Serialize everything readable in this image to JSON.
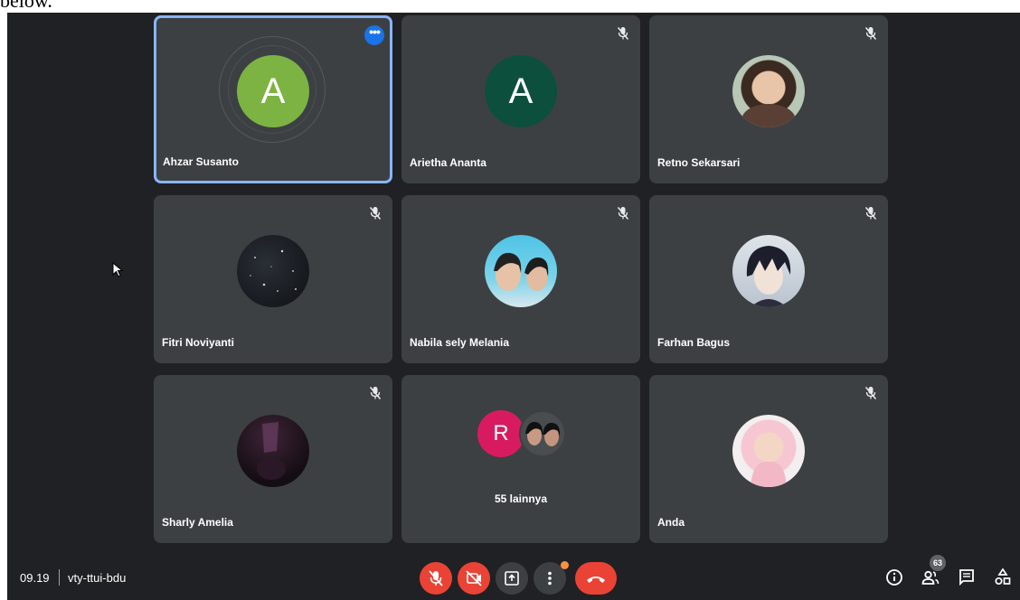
{
  "caption_fragment": "below.",
  "meeting": {
    "time": "09.19",
    "code": "vty-ttui-bdu"
  },
  "participants": [
    {
      "name": "Ahzar Susanto",
      "avatar": "letter",
      "initial": "A",
      "color": "#7cb342",
      "active": true
    },
    {
      "name": "Arietha Ananta",
      "avatar": "letter",
      "initial": "A",
      "color": "#0d4f3d",
      "muted": true
    },
    {
      "name": "Retno Sekarsari",
      "avatar": "photo",
      "muted": true
    },
    {
      "name": "Fitri Noviyanti",
      "avatar": "photo",
      "muted": true
    },
    {
      "name": "Nabila sely Melania",
      "avatar": "photo",
      "muted": true
    },
    {
      "name": "Farhan Bagus",
      "avatar": "photo",
      "muted": true
    },
    {
      "name": "Sharly Amelia",
      "avatar": "photo",
      "muted": true
    },
    {
      "name": "",
      "group_initial": "R",
      "group_color": "#d81b60",
      "group_label": "55 lainnya"
    },
    {
      "name": "Anda",
      "avatar": "photo",
      "muted": true
    }
  ],
  "controls": {
    "mic": "mic-off-icon",
    "camera": "camera-off-icon",
    "present": "present-icon",
    "more": "more-vert-icon",
    "end_call": "end-call-icon"
  },
  "right_panel": {
    "people_count": "63",
    "icons": [
      "info-icon",
      "people-icon",
      "chat-icon",
      "activities-icon"
    ]
  },
  "colors": {
    "background": "#202124",
    "tile": "#3c4043",
    "active_border": "#8ab4f8",
    "danger": "#ea4335",
    "accent": "#1a73e8"
  }
}
